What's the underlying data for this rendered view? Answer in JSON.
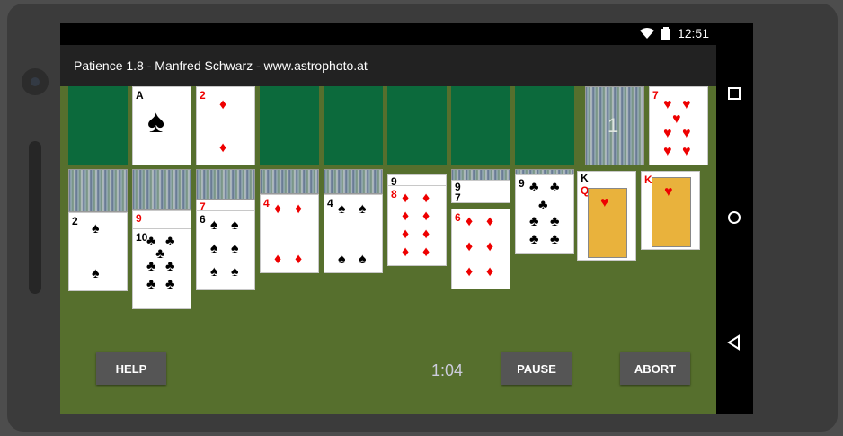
{
  "status": {
    "time": "12:51",
    "wifi_icon": "wifi-icon",
    "battery_icon": "battery-icon"
  },
  "app": {
    "title": "Patience 1.8 - Manfred Schwarz - www.astrophoto.at"
  },
  "stock": {
    "count": "1"
  },
  "waste": {
    "rank": "7",
    "suit": "♥"
  },
  "foundations": [
    {
      "rank": "A",
      "suit": "♠"
    },
    {
      "rank": "2",
      "suit": "♦"
    }
  ],
  "tableau": [
    {
      "top_rank": "2",
      "top_suit": "♠"
    },
    {
      "ranks": [
        "9",
        "10"
      ],
      "suits": [
        "♥",
        "♣"
      ]
    },
    {
      "ranks": [
        "7",
        "6"
      ],
      "suits": [
        "♦",
        "♠"
      ]
    },
    {
      "top_rank": "4",
      "top_suit": "♦"
    },
    {
      "top_rank": "4",
      "top_suit": "♠"
    },
    {
      "ranks": [
        "9",
        "8"
      ],
      "suits": [
        "♣",
        "♦"
      ]
    },
    {
      "ranks": [
        "9",
        "7",
        "6"
      ],
      "suits": [
        "♠",
        "♥",
        "♦"
      ]
    },
    {
      "top_rank": "9",
      "top_suit": "♣"
    },
    {
      "ranks": [
        "K",
        "Q"
      ],
      "suits": [
        "♣",
        "♥"
      ]
    },
    {
      "top_rank": "K",
      "top_suit": "♥"
    }
  ],
  "buttons": {
    "help": "HELP",
    "pause": "PAUSE",
    "abort": "ABORT"
  },
  "timer": "1:04"
}
